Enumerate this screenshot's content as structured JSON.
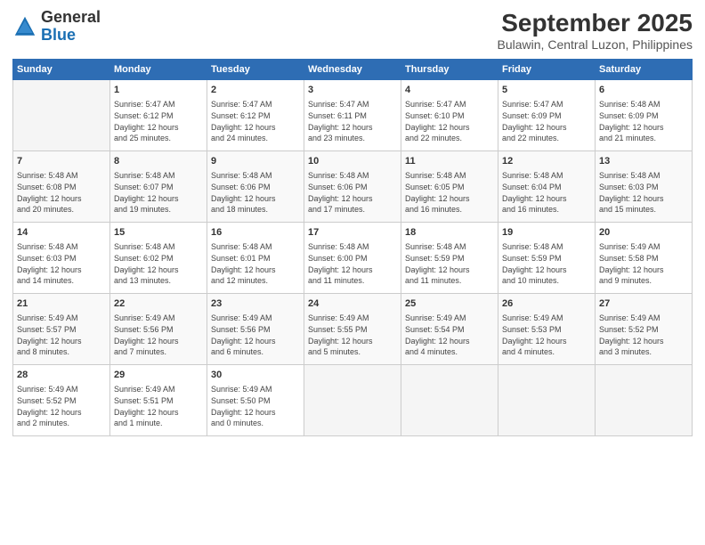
{
  "logo": {
    "line1": "General",
    "line2": "Blue"
  },
  "title": "September 2025",
  "subtitle": "Bulawin, Central Luzon, Philippines",
  "days_header": [
    "Sunday",
    "Monday",
    "Tuesday",
    "Wednesday",
    "Thursday",
    "Friday",
    "Saturday"
  ],
  "weeks": [
    [
      {
        "day": "",
        "info": ""
      },
      {
        "day": "1",
        "info": "Sunrise: 5:47 AM\nSunset: 6:12 PM\nDaylight: 12 hours\nand 25 minutes."
      },
      {
        "day": "2",
        "info": "Sunrise: 5:47 AM\nSunset: 6:12 PM\nDaylight: 12 hours\nand 24 minutes."
      },
      {
        "day": "3",
        "info": "Sunrise: 5:47 AM\nSunset: 6:11 PM\nDaylight: 12 hours\nand 23 minutes."
      },
      {
        "day": "4",
        "info": "Sunrise: 5:47 AM\nSunset: 6:10 PM\nDaylight: 12 hours\nand 22 minutes."
      },
      {
        "day": "5",
        "info": "Sunrise: 5:47 AM\nSunset: 6:09 PM\nDaylight: 12 hours\nand 22 minutes."
      },
      {
        "day": "6",
        "info": "Sunrise: 5:48 AM\nSunset: 6:09 PM\nDaylight: 12 hours\nand 21 minutes."
      }
    ],
    [
      {
        "day": "7",
        "info": "Sunrise: 5:48 AM\nSunset: 6:08 PM\nDaylight: 12 hours\nand 20 minutes."
      },
      {
        "day": "8",
        "info": "Sunrise: 5:48 AM\nSunset: 6:07 PM\nDaylight: 12 hours\nand 19 minutes."
      },
      {
        "day": "9",
        "info": "Sunrise: 5:48 AM\nSunset: 6:06 PM\nDaylight: 12 hours\nand 18 minutes."
      },
      {
        "day": "10",
        "info": "Sunrise: 5:48 AM\nSunset: 6:06 PM\nDaylight: 12 hours\nand 17 minutes."
      },
      {
        "day": "11",
        "info": "Sunrise: 5:48 AM\nSunset: 6:05 PM\nDaylight: 12 hours\nand 16 minutes."
      },
      {
        "day": "12",
        "info": "Sunrise: 5:48 AM\nSunset: 6:04 PM\nDaylight: 12 hours\nand 16 minutes."
      },
      {
        "day": "13",
        "info": "Sunrise: 5:48 AM\nSunset: 6:03 PM\nDaylight: 12 hours\nand 15 minutes."
      }
    ],
    [
      {
        "day": "14",
        "info": "Sunrise: 5:48 AM\nSunset: 6:03 PM\nDaylight: 12 hours\nand 14 minutes."
      },
      {
        "day": "15",
        "info": "Sunrise: 5:48 AM\nSunset: 6:02 PM\nDaylight: 12 hours\nand 13 minutes."
      },
      {
        "day": "16",
        "info": "Sunrise: 5:48 AM\nSunset: 6:01 PM\nDaylight: 12 hours\nand 12 minutes."
      },
      {
        "day": "17",
        "info": "Sunrise: 5:48 AM\nSunset: 6:00 PM\nDaylight: 12 hours\nand 11 minutes."
      },
      {
        "day": "18",
        "info": "Sunrise: 5:48 AM\nSunset: 5:59 PM\nDaylight: 12 hours\nand 11 minutes."
      },
      {
        "day": "19",
        "info": "Sunrise: 5:48 AM\nSunset: 5:59 PM\nDaylight: 12 hours\nand 10 minutes."
      },
      {
        "day": "20",
        "info": "Sunrise: 5:49 AM\nSunset: 5:58 PM\nDaylight: 12 hours\nand 9 minutes."
      }
    ],
    [
      {
        "day": "21",
        "info": "Sunrise: 5:49 AM\nSunset: 5:57 PM\nDaylight: 12 hours\nand 8 minutes."
      },
      {
        "day": "22",
        "info": "Sunrise: 5:49 AM\nSunset: 5:56 PM\nDaylight: 12 hours\nand 7 minutes."
      },
      {
        "day": "23",
        "info": "Sunrise: 5:49 AM\nSunset: 5:56 PM\nDaylight: 12 hours\nand 6 minutes."
      },
      {
        "day": "24",
        "info": "Sunrise: 5:49 AM\nSunset: 5:55 PM\nDaylight: 12 hours\nand 5 minutes."
      },
      {
        "day": "25",
        "info": "Sunrise: 5:49 AM\nSunset: 5:54 PM\nDaylight: 12 hours\nand 4 minutes."
      },
      {
        "day": "26",
        "info": "Sunrise: 5:49 AM\nSunset: 5:53 PM\nDaylight: 12 hours\nand 4 minutes."
      },
      {
        "day": "27",
        "info": "Sunrise: 5:49 AM\nSunset: 5:52 PM\nDaylight: 12 hours\nand 3 minutes."
      }
    ],
    [
      {
        "day": "28",
        "info": "Sunrise: 5:49 AM\nSunset: 5:52 PM\nDaylight: 12 hours\nand 2 minutes."
      },
      {
        "day": "29",
        "info": "Sunrise: 5:49 AM\nSunset: 5:51 PM\nDaylight: 12 hours\nand 1 minute."
      },
      {
        "day": "30",
        "info": "Sunrise: 5:49 AM\nSunset: 5:50 PM\nDaylight: 12 hours\nand 0 minutes."
      },
      {
        "day": "",
        "info": ""
      },
      {
        "day": "",
        "info": ""
      },
      {
        "day": "",
        "info": ""
      },
      {
        "day": "",
        "info": ""
      }
    ]
  ]
}
